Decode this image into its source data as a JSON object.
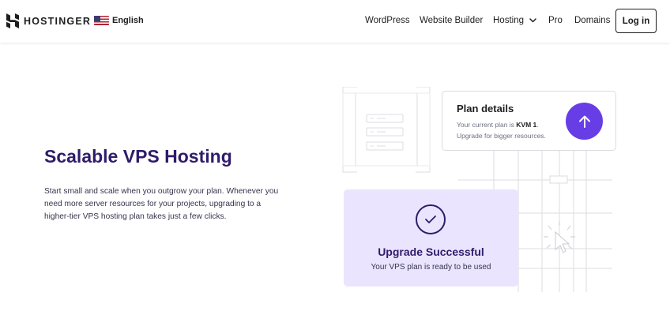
{
  "header": {
    "brand": "HOSTINGER",
    "language": "English",
    "nav": {
      "wordpress": "WordPress",
      "website_builder": "Website Builder",
      "hosting": "Hosting",
      "pro": "Pro",
      "domains": "Domains"
    },
    "login_label": "Log in"
  },
  "hero": {
    "title": "Scalable VPS Hosting",
    "description": "Start small and scale when you outgrow your plan. Whenever you need more server resources for your projects, upgrading to a higher-tier VPS hosting plan takes just a few clicks."
  },
  "plan_card": {
    "title": "Plan details",
    "current_prefix": "Your current plan is ",
    "current_plan": "KVM 1",
    "current_suffix": ".",
    "upgrade_hint": "Upgrade for bigger resources."
  },
  "success_card": {
    "title": "Upgrade Successful",
    "subtitle": "Your VPS plan is ready to be used"
  },
  "colors": {
    "brand_purple": "#673de6",
    "heading_navy": "#2f1c6a",
    "success_bg": "#ebe4ff"
  },
  "icons": [
    "hostinger-logo-icon",
    "us-flag-icon",
    "chevron-down-icon",
    "arrow-up-icon",
    "checkmark-icon",
    "cursor-click-icon",
    "server-icon"
  ]
}
